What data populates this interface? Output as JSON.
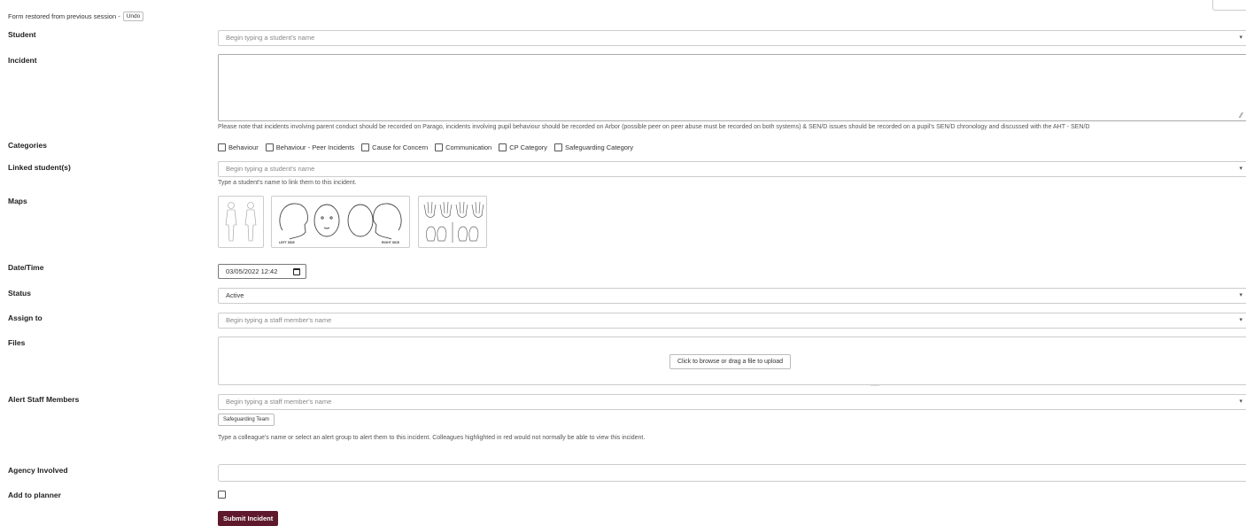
{
  "restore": {
    "text": "Form restored from previous session -",
    "undo_label": "Undo"
  },
  "labels": {
    "student": "Student",
    "incident": "Incident",
    "categories": "Categories",
    "linked": "Linked student(s)",
    "maps": "Maps",
    "datetime": "Date/Time",
    "status": "Status",
    "assign": "Assign to",
    "files": "Files",
    "alert": "Alert Staff Members",
    "agency": "Agency Involved",
    "planner": "Add to planner"
  },
  "student_select": {
    "placeholder": "Begin typing a student's name"
  },
  "incident_help": "Please note that incidents involving parent conduct should be recorded on Parago, incidents involving pupil behaviour should be recorded on Arbor (possible peer on peer abuse must be recorded on both systems) & SEN/D issues should be recorded on a pupil's SEN/D chronology and discussed with the AHT - SEN/D",
  "categories": [
    "Behaviour",
    "Behaviour - Peer Incidents",
    "Cause for Concern",
    "Communication",
    "CP Category",
    "Safeguarding Category"
  ],
  "linked_select": {
    "placeholder": "Begin typing a student's name",
    "help": "Type a student's name to link them to this incident."
  },
  "maps": {
    "body_icon": "body-map-icon",
    "head_icon": "head-map-icon",
    "head_left": "LEFT SIDE",
    "head_right": "RIGHT SIDE",
    "hands_icon": "hands-feet-map-icon"
  },
  "datetime_value": "03/05/2022 12:42",
  "status_value": "Active",
  "assign_select": {
    "placeholder": "Begin typing a staff member's name"
  },
  "files": {
    "upload_label": "Click to browse or drag a file to upload"
  },
  "alert_select": {
    "placeholder": "Begin typing a staff member's name",
    "group_button": "Safeguarding Team",
    "help": "Type a colleague's name or select an alert group to alert them to this incident. Colleagues highlighted in red would not normally be able to view this incident."
  },
  "submit_label": "Submit Incident",
  "colors": {
    "submit_bg": "#5e1a2c"
  }
}
